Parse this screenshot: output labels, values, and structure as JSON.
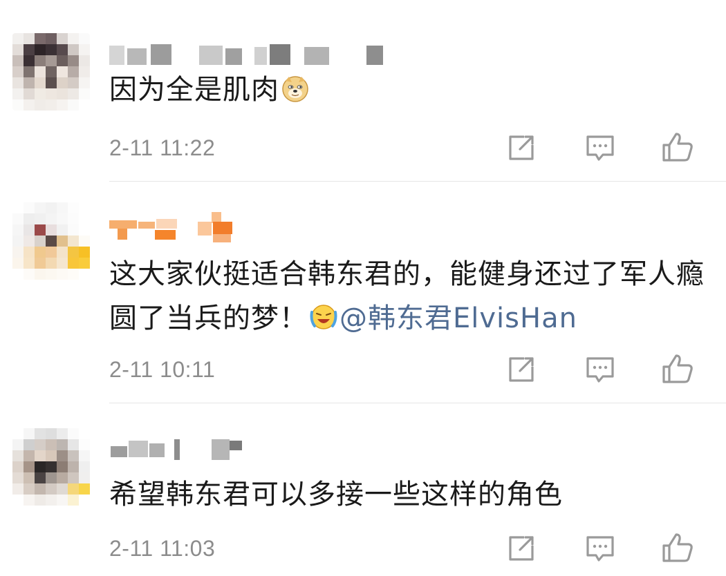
{
  "comments": [
    {
      "username": "",
      "text": "因为全是肌肉",
      "emoji": "doge-emoji",
      "mention": "",
      "time": "2-11 11:22"
    },
    {
      "username": "",
      "text": "这大家伙挺适合韩东君的，能健身还过了军人瘾圆了当兵的梦！",
      "emoji": "laugh-cry-emoji",
      "mention": "@韩东君ElvisHan",
      "time": "2-11 10:11"
    },
    {
      "username": "",
      "text": "希望韩东君可以多接一些这样的角色",
      "emoji": "",
      "mention": "",
      "time": "2-11 11:03"
    }
  ],
  "icons": {
    "repost": "repost-icon",
    "comment": "comment-icon",
    "like": "like-icon"
  },
  "colors": {
    "text": "#1a1a1a",
    "time": "#8c8c8c",
    "mention": "#4f6b92",
    "icon": "#9a9a9a",
    "divider": "#e6e6e6"
  }
}
